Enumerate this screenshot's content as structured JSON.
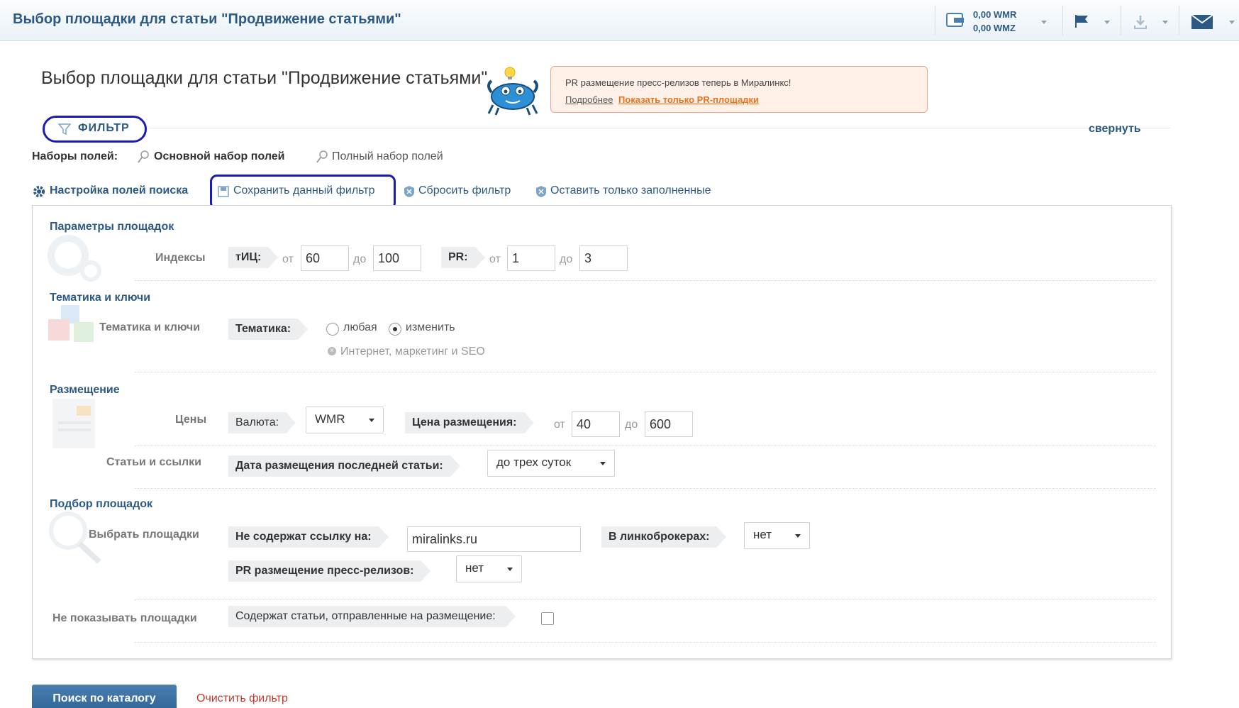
{
  "topbar": {
    "title": "Выбор площадки для статьи \"Продвижение статьями\"",
    "balance_wmr": "0,00 WMR",
    "balance_wmz": "0,00 WMZ"
  },
  "heading": {
    "title": "Выбор площадки для статьи \"Продвижение статьями\""
  },
  "notice": {
    "text": "PR размещение пресс-релизов теперь в Миралинкс!",
    "more_link": "Подробнее",
    "pr_link": "Показать только PR-площадки"
  },
  "filter": {
    "label": "ФИЛЬТР",
    "collapse": "свернуть",
    "fieldsets_label": "Наборы полей:",
    "fieldset_main": "Основной набор полей",
    "fieldset_full": "Полный набор полей",
    "actions": {
      "setup": "Настройка полей поиска",
      "save": "Сохранить данный фильтр",
      "reset": "Сбросить фильтр",
      "keep_filled": "Оставить только заполненные"
    }
  },
  "sections": {
    "params": {
      "title": "Параметры площадок",
      "row_label": "Индексы",
      "tic_label": "тИЦ:",
      "from": "от",
      "to": "до",
      "tic_from": "60",
      "tic_to": "100",
      "pr_label": "PR:",
      "pr_from": "1",
      "pr_to": "3"
    },
    "topics": {
      "title": "Тематика и ключи",
      "row_label": "Тематика и ключи",
      "field_label": "Тематика:",
      "opt_any": "любая",
      "opt_change": "изменить",
      "selected_topic": "Интернет, маркетинг и SEO"
    },
    "placement": {
      "title": "Размещение",
      "prices_label": "Цены",
      "currency_label": "Валюта:",
      "currency_value": "WMR",
      "price_label": "Цена размещения:",
      "price_from": "40",
      "price_to": "600",
      "articles_label": "Статьи и ссылки",
      "last_date_label": "Дата размещения последней статьи:",
      "last_date_value": "до трех суток"
    },
    "selection": {
      "title": "Подбор площадок",
      "row_label": "Выбрать площадки",
      "no_link_label": "Не содержат ссылку на:",
      "no_link_value": "miralinks.ru",
      "brokers_label": "В линкоброкерах:",
      "brokers_value": "нет",
      "pr_label": "PR размещение пресс-релизов:",
      "pr_value": "нет"
    },
    "hide": {
      "row_label": "Не показывать площадки",
      "field_label": "Содержат статьи, отправленные на размещение:"
    }
  },
  "footer": {
    "search_button": "Поиск по каталогу",
    "clear_link": "Очистить фильтр"
  }
}
